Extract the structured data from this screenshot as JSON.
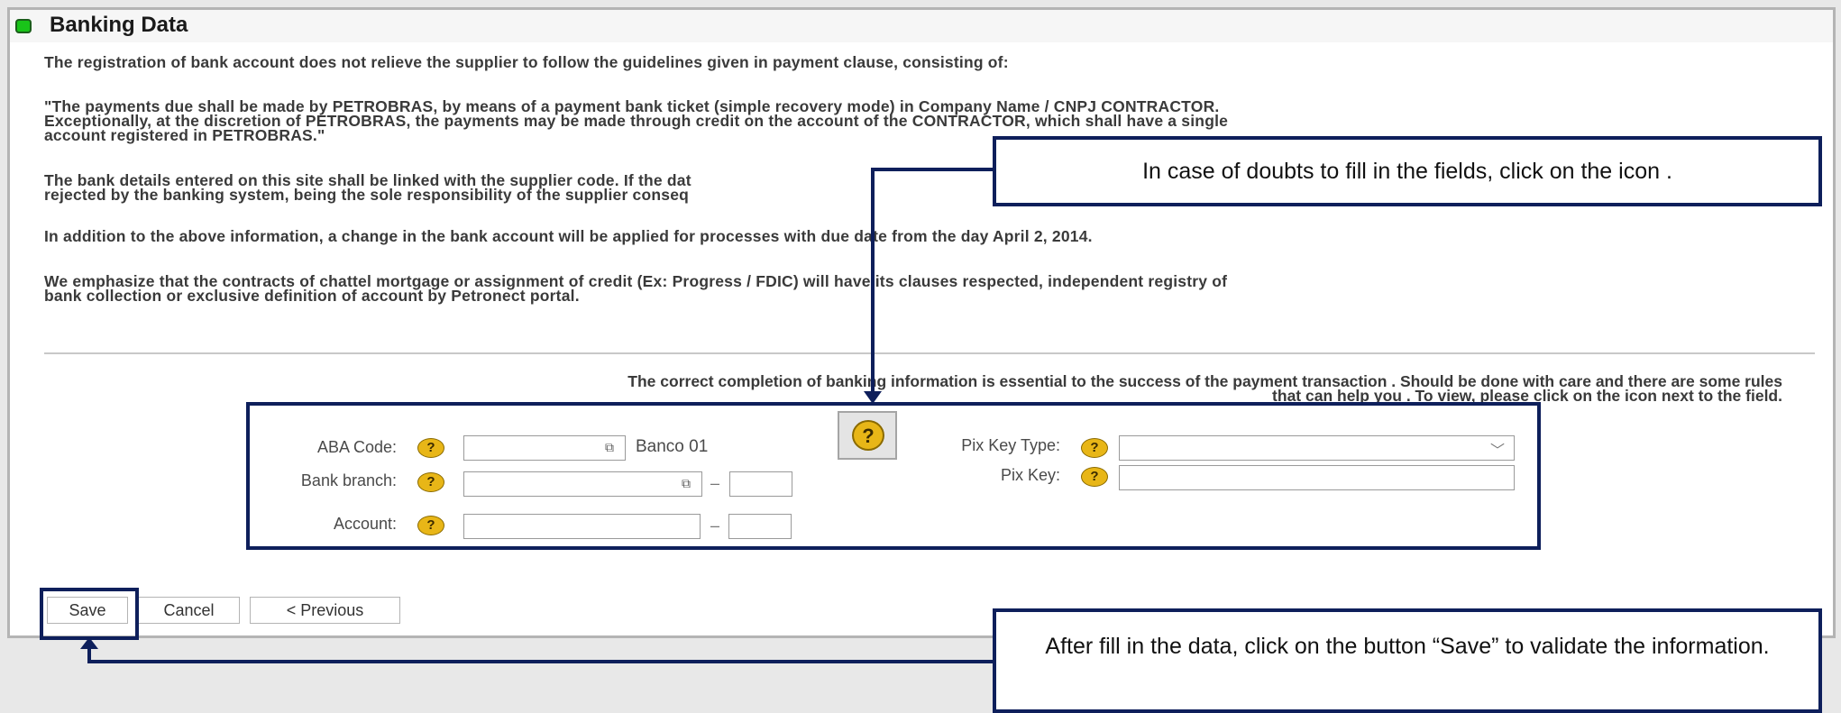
{
  "header": {
    "title": "Banking Data"
  },
  "paragraphs": [
    "The registration of bank account does not relieve the supplier to follow the guidelines given in payment clause, consisting of:",
    "\"The payments due shall be made by PETROBRAS, by means of a payment bank ticket (simple recovery mode) in Company Name / CNPJ CONTRACTOR.\nExceptionally, at the discretion of PETROBRAS, the payments may be made through credit on the account of the CONTRACTOR, which shall have a single\naccount registered in PETROBRAS.\"",
    "The bank details entered on this site shall be linked with the supplier code. If the dat\nrejected by the banking system, being the sole responsibility of the supplier conseq",
    "In addition to the above information, a change in the bank account will be applied for processes with due date from the day April 2, 2014.",
    "We emphasize that the contracts of chattel mortgage or assignment of credit (Ex: Progress / FDIC) will have its clauses respected, independent registry of\nbank collection or exclusive definition of account by Petronect portal."
  ],
  "note": "The correct completion of banking information is essential to the success of the payment transaction . Should be done with care and there are some rules\nthat can help you . To view, please click on the icon next to the field.",
  "form": {
    "aba_code_label": "ABA Code:",
    "aba_code_value": "",
    "bank_name": "Banco 01",
    "bank_branch_label": "Bank branch:",
    "bank_branch_value": "",
    "bank_branch_digit": "",
    "account_label": "Account:",
    "account_value": "",
    "account_digit": "",
    "pix_key_type_label": "Pix Key Type:",
    "pix_key_type_value": "",
    "pix_key_label": "Pix Key:",
    "pix_key_value": "",
    "separator": "–"
  },
  "buttons": {
    "save": "Save",
    "cancel": "Cancel",
    "previous": "< Previous"
  },
  "callouts": {
    "help_hint": "In case of doubts to fill in the fields, click on the icon       .",
    "save_hint": "After fill in the data, click on the button “Save” to validate the information."
  },
  "icons": {
    "status": "green-led-icon",
    "help": "question-help-icon",
    "lookup": "value-help-lookup-icon",
    "dropdown": "chevron-down-icon"
  },
  "colors": {
    "callout_border": "#0e1f5b",
    "help_icon": "#e8b617",
    "status_led": "#19c419"
  }
}
